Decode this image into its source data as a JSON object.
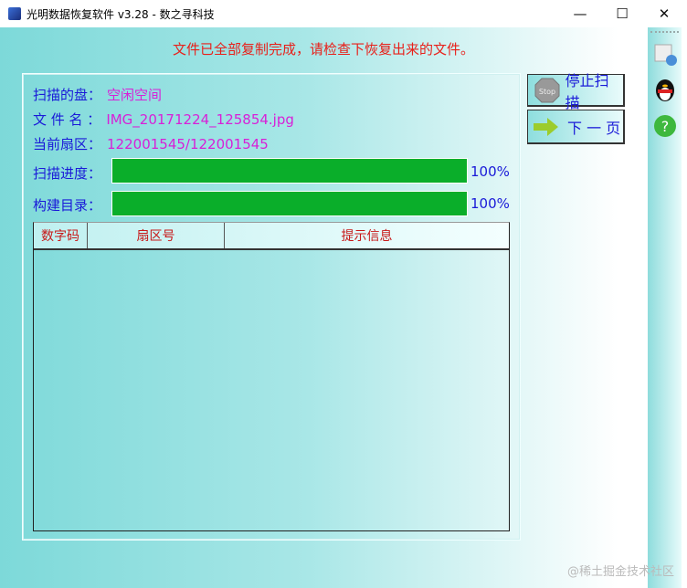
{
  "window": {
    "title": "光明数据恢复软件 v3.28 - 数之寻科技",
    "minimize": "—",
    "maximize": "☐",
    "close": "✕"
  },
  "message": "文件已全部复制完成，请检查下恢复出来的文件。",
  "info": {
    "disk_label": "扫描的盘：",
    "disk_value": "空闲空间",
    "file_label": "文 件 名 ：",
    "file_value": "IMG_20171224_125854.jpg",
    "sector_label": "当前扇区：",
    "sector_value": "122001545/122001545",
    "scan_label": "扫描进度：",
    "scan_percent": "100%",
    "scan_progress": 100,
    "build_label": "构建目录：",
    "build_percent": "100%",
    "build_progress": 100
  },
  "table": {
    "columns": [
      "数字码",
      "扇区号",
      "提示信息"
    ],
    "rows": []
  },
  "buttons": {
    "stop": "停止扫描",
    "stop_icon_text": "Stop",
    "next": "下 一 页"
  },
  "sidebar": {
    "icons": [
      "settings-icon",
      "qq-icon",
      "help-icon"
    ],
    "help_glyph": "?"
  },
  "watermark": "@稀土掘金技术社区",
  "colors": {
    "progress": "#0aae2a",
    "message": "#e8201a",
    "label": "#1a1ad8",
    "value": "#d820d8"
  }
}
